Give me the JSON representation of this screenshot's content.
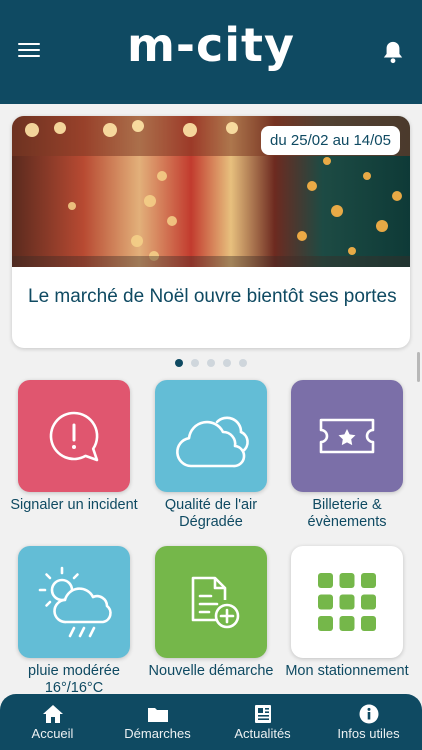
{
  "header": {
    "logo": "m-city"
  },
  "featured": {
    "date": "du 25/02 au 14/05",
    "title": "Le marché de Noël ouvre bientôt ses portes",
    "pages": 5,
    "active_page": 1
  },
  "tiles": [
    {
      "label": "Signaler un incident",
      "icon": "alert-bubble-icon",
      "color": "#e0566f"
    },
    {
      "label": "Qualité de l'air Dégradée",
      "icon": "cloud-icon",
      "color": "#63bdd6"
    },
    {
      "label": "Billeterie & évènements",
      "icon": "ticket-icon",
      "color": "#7b6fa8"
    },
    {
      "label": "pluie modérée 16°/16°C",
      "icon": "rain-sun-icon",
      "color": "#63bdd6"
    },
    {
      "label": "Nouvelle démarche",
      "icon": "document-add-icon",
      "color": "#75b74a"
    },
    {
      "label": "Mon stationnement",
      "icon": "grid-apps-icon",
      "color": "#ffffff"
    }
  ],
  "nav": [
    {
      "label": "Accueil",
      "icon": "home-icon"
    },
    {
      "label": "Démarches",
      "icon": "folder-icon"
    },
    {
      "label": "Actualités",
      "icon": "newspaper-icon"
    },
    {
      "label": "Infos utiles",
      "icon": "info-icon"
    }
  ],
  "colors": {
    "primary": "#0f4a62",
    "background": "#f1f1f1",
    "green_accent": "#75b74a"
  }
}
